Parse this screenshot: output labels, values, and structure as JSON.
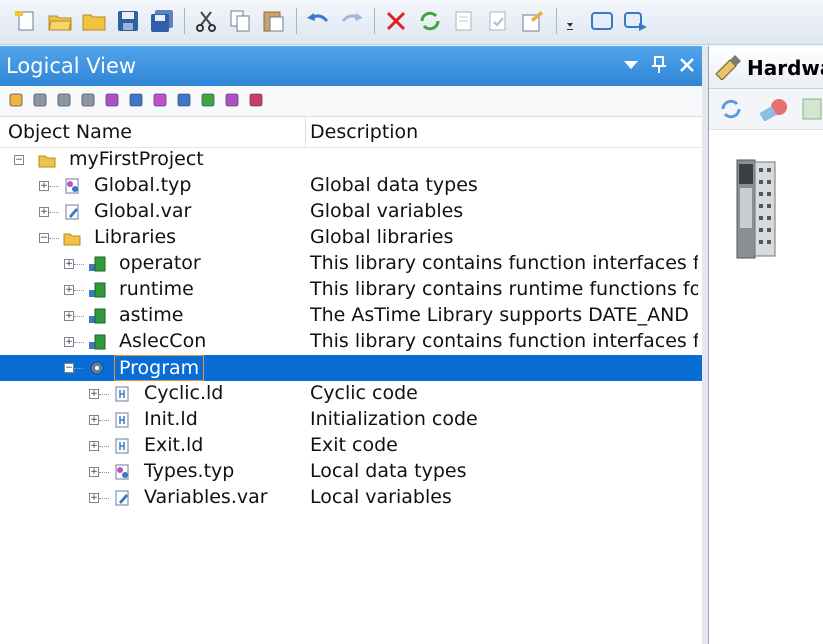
{
  "toolbar": {
    "icons": [
      "new-file-icon",
      "open-folder-icon",
      "folder-icon",
      "save-icon",
      "save-all-icon",
      "cut-icon",
      "copy-icon",
      "paste-icon",
      "undo-icon",
      "redo-icon",
      "delete-icon",
      "refresh-icon",
      "properties-icon",
      "check-icon",
      "settings-icon",
      "window-icon",
      "next-window-icon"
    ]
  },
  "logical_view": {
    "title": "Logical View",
    "columns": {
      "name": "Object Name",
      "description": "Description"
    },
    "toolbar_icons": [
      "package-icon",
      "grid-icon",
      "table-icon",
      "header-icon",
      "types-icon",
      "variables-icon",
      "library-icon",
      "edit-icon",
      "program-icon",
      "network-icon",
      "remove-icon"
    ],
    "tree": [
      {
        "label": "myFirstProject",
        "description": "",
        "icon": "folder-icon",
        "level": 0,
        "expander": "minus"
      },
      {
        "label": "Global.typ",
        "description": "Global data types",
        "icon": "types-icon",
        "level": 1,
        "expander": "plus"
      },
      {
        "label": "Global.var",
        "description": "Global variables",
        "icon": "variables-icon",
        "level": 1,
        "expander": "plus"
      },
      {
        "label": "Libraries",
        "description": "Global libraries",
        "icon": "folder-icon",
        "level": 1,
        "expander": "minus"
      },
      {
        "label": "operator",
        "description": "This library contains function interfaces f",
        "icon": "library-icon",
        "level": 2,
        "expander": "plus"
      },
      {
        "label": "runtime",
        "description": "This library contains runtime functions fo",
        "icon": "library-icon",
        "level": 2,
        "expander": "plus"
      },
      {
        "label": "astime",
        "description": "The AsTime Library supports DATE_AND",
        "icon": "library-icon",
        "level": 2,
        "expander": "plus"
      },
      {
        "label": "AslecCon",
        "description": "This library contains function interfaces f",
        "icon": "library-icon",
        "level": 2,
        "expander": "plus"
      },
      {
        "label": "Program",
        "description": "",
        "icon": "program-icon",
        "level": 2,
        "expander": "minus",
        "selected": true
      },
      {
        "label": "Cyclic.ld",
        "description": "Cyclic code",
        "icon": "ladder-icon",
        "level": 3,
        "expander": "plus"
      },
      {
        "label": "Init.ld",
        "description": "Initialization code",
        "icon": "ladder-icon",
        "level": 3,
        "expander": "plus"
      },
      {
        "label": "Exit.ld",
        "description": "Exit code",
        "icon": "ladder-icon",
        "level": 3,
        "expander": "plus"
      },
      {
        "label": "Types.typ",
        "description": "Local data types",
        "icon": "types-icon",
        "level": 3,
        "expander": "plus"
      },
      {
        "label": "Variables.var",
        "description": "Local variables",
        "icon": "variables-icon",
        "level": 3,
        "expander": "plus"
      }
    ]
  },
  "hardware_view": {
    "title": "Hardwa",
    "toolbar_icons": [
      "refresh-icon",
      "hardware-tool-icon",
      "module-icon"
    ],
    "device_icon": "plc-module-icon"
  },
  "colors": {
    "accent": "#2f86d6",
    "selection": "#0a6cd5",
    "selection_border": "#e8922f"
  }
}
